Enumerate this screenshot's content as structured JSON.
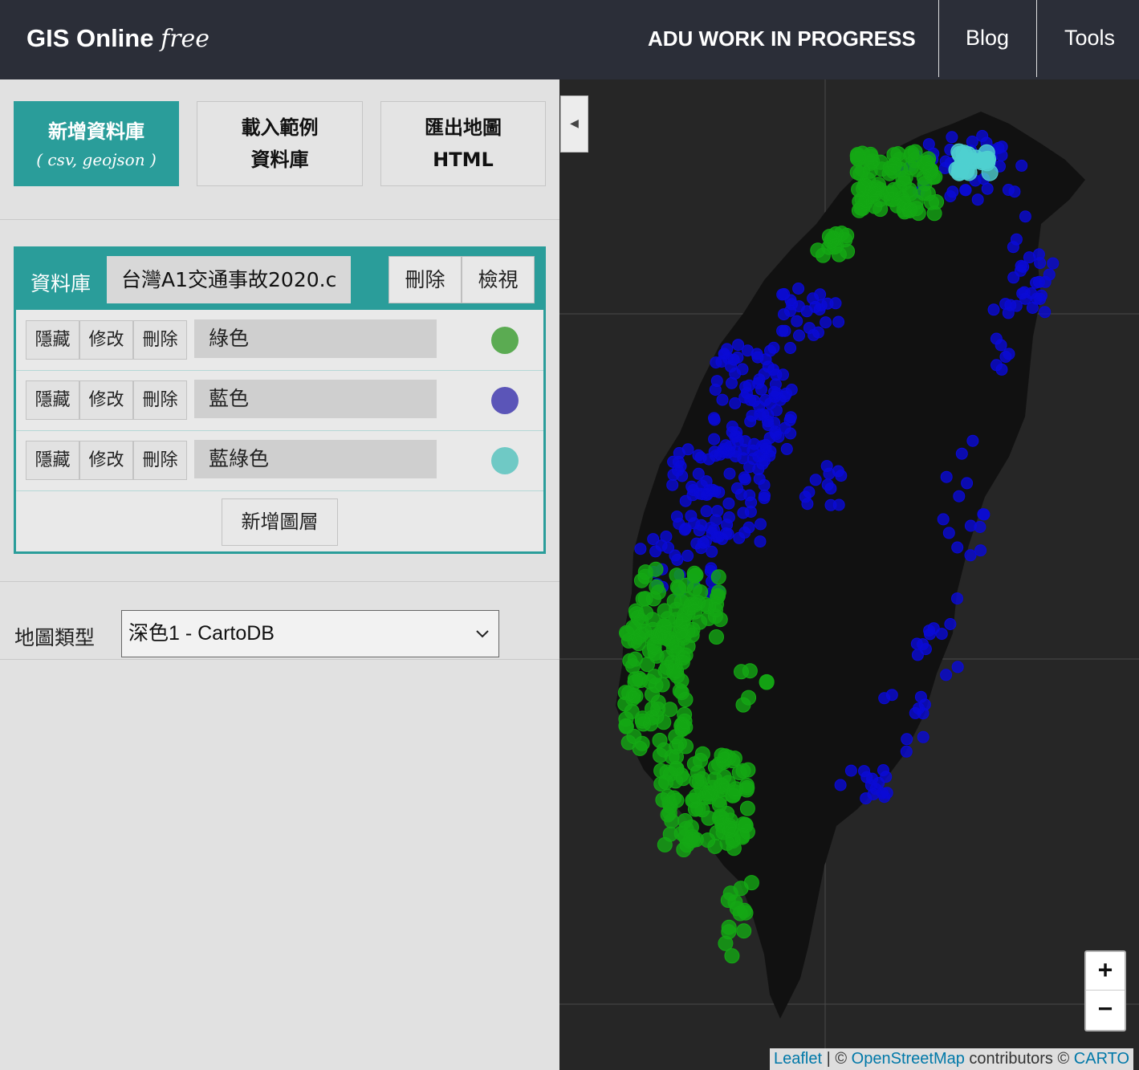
{
  "header": {
    "brand_main": "GIS Online",
    "brand_sub": "free",
    "nav": {
      "work_in_progress": "ADU WORK IN PROGRESS",
      "blog": "Blog",
      "tools": "Tools"
    }
  },
  "sidebar": {
    "toolbar": {
      "new_db_label": "新增資料庫",
      "new_db_sub": "( csv, geojson )",
      "load_example_line1": "載入範例",
      "load_example_line2": "資料庫",
      "export_line1": "匯出地圖",
      "export_line2": "HTML"
    },
    "database": {
      "label": "資料庫",
      "name": "台灣A1交通事故2020.c",
      "delete_label": "刪除",
      "view_label": "檢視"
    },
    "layers": [
      {
        "hide": "隱藏",
        "edit": "修改",
        "delete": "刪除",
        "name": "綠色",
        "color": "#5bab52"
      },
      {
        "hide": "隱藏",
        "edit": "修改",
        "delete": "刪除",
        "name": "藍色",
        "color": "#5b55b8"
      },
      {
        "hide": "隱藏",
        "edit": "修改",
        "delete": "刪除",
        "name": "藍綠色",
        "color": "#6fc9c5"
      }
    ],
    "add_layer_label": "新增圖層",
    "map_type": {
      "label": "地圖類型",
      "selected": "深色1 - CartoDB"
    }
  },
  "map": {
    "toggle_label": "◀",
    "zoom_in": "+",
    "zoom_out": "−",
    "attribution": {
      "leaflet": "Leaflet",
      "sep": " | © ",
      "osm": "OpenStreetMap",
      "contributors": " contributors © ",
      "carto": "CARTO"
    },
    "colors": {
      "land": "#111111",
      "sea": "#262626",
      "blue_points": "#0a0ad6",
      "green_points": "#14a814",
      "teal_points": "#4fd0d0"
    }
  }
}
